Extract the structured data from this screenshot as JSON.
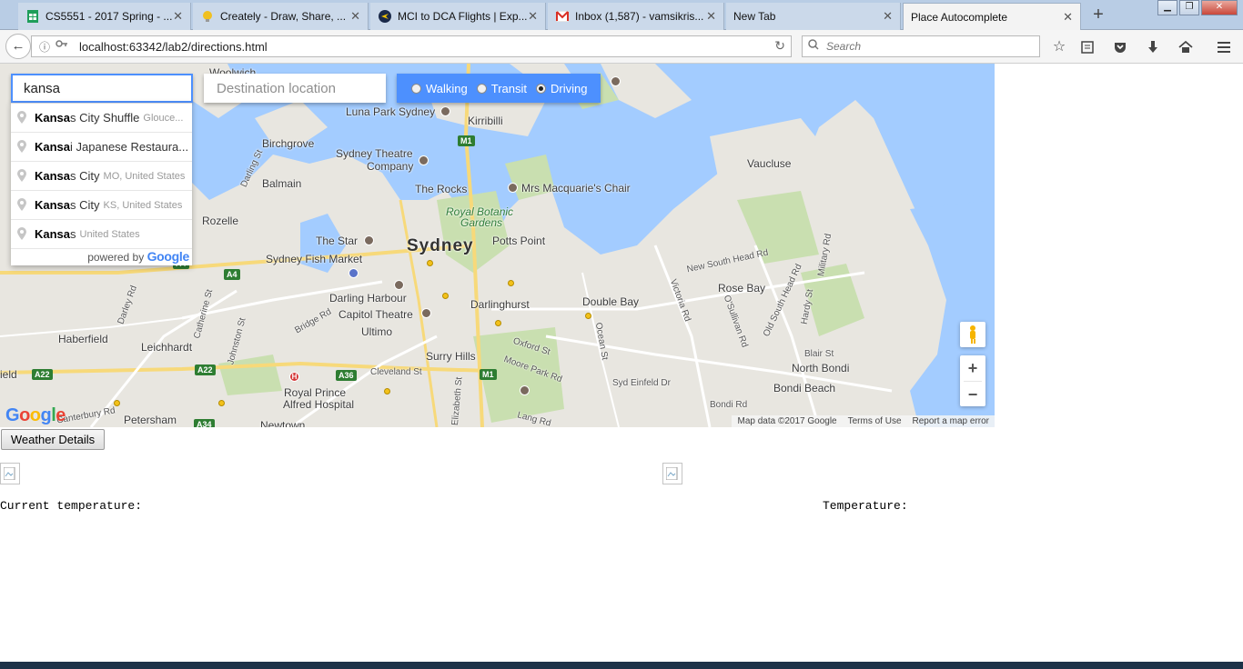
{
  "browser": {
    "tabs": [
      {
        "title": "CS5551 - 2017 Spring - ...",
        "icon": "sheets-icon",
        "color": "#1e9e5a"
      },
      {
        "title": "Creately - Draw, Share, ...",
        "icon": "bulb-icon",
        "color": "#f0c020"
      },
      {
        "title": "MCI to DCA Flights | Exp...",
        "icon": "plane-icon",
        "color": "#f5c400"
      },
      {
        "title": "Inbox (1,587) - vamsikris...",
        "icon": "gmail-icon",
        "color": "#d93025"
      },
      {
        "title": "New Tab",
        "icon": "",
        "color": ""
      },
      {
        "title": "Place Autocomplete",
        "icon": "",
        "color": "",
        "active": true
      }
    ],
    "url": "localhost:63342/lab2/directions.html",
    "search_placeholder": "Search"
  },
  "map": {
    "origin_value": "kansa",
    "destination_placeholder": "Destination location",
    "modes": [
      {
        "label": "Walking",
        "selected": false
      },
      {
        "label": "Transit",
        "selected": false
      },
      {
        "label": "Driving",
        "selected": true
      }
    ],
    "suggestions": [
      {
        "match": "Kansa",
        "rest": "s City Shuffle",
        "secondary": "Glouce..."
      },
      {
        "match": "Kansa",
        "rest": "i Japanese Restaura...",
        "secondary": ""
      },
      {
        "match": "Kansa",
        "rest": "s City",
        "secondary": "MO, United States"
      },
      {
        "match": "Kansa",
        "rest": "s City",
        "secondary": "KS, United States"
      },
      {
        "match": "Kansa",
        "rest": "s",
        "secondary": "United States"
      }
    ],
    "powered_by": "powered by",
    "google_word": "Google",
    "labels": {
      "woolwich": "Woolwich",
      "luna_park": "Luna Park Sydney",
      "kirribilli": "Kirribilli",
      "birchgrove": "Birchgrove",
      "sydney_theatre": "Sydney Theatre",
      "company": "Company",
      "balmain": "Balmain",
      "the_rocks": "The Rocks",
      "mrs_macquarie": "Mrs Macquarie's Chair",
      "vaucluse": "Vaucluse",
      "royal_botanic": "Royal Botanic",
      "gardens": "Gardens",
      "rozelle": "Rozelle",
      "the_star": "The Star",
      "sydney": "Sydney",
      "potts_point": "Potts Point",
      "sydney_fish": "Sydney Fish Market",
      "new_south_head": "New South Head Rd",
      "rose_bay": "Rose Bay",
      "darling_harbour": "Darling Harbour",
      "darlinghurst": "Darlinghurst",
      "double_bay": "Double Bay",
      "capitol": "Capitol Theatre",
      "haberfield": "Haberfield",
      "leichhardt": "Leichhardt",
      "ultimo": "Ultimo",
      "surry_hills": "Surry Hills",
      "blair_st": "Blair St",
      "north_bondi": "North Bondi",
      "bondi_beach": "Bondi Beach",
      "royal_prince": "Royal Prince",
      "alfred": "Alfred Hospital",
      "petersham": "Petersham",
      "newtown": "Newtown",
      "field": "ield",
      "oxford_st": "Oxford St",
      "moore_park": "Moore Park Rd",
      "syd_einfeld": "Syd Einfeld Dr",
      "bondi_rd": "Bondi Rd",
      "lang_rd": "Lang Rd",
      "cleveland_st": "Cleveland St",
      "bridge_rd": "Bridge Rd",
      "catherine_st": "Catherine St",
      "johnston_st": "Johnston St",
      "darley_rd": "Darley Rd",
      "victoria_rd": "Victoria Rd",
      "military_rd": "Military Rd",
      "old_south_head": "Old South Head Rd",
      "osullivan_rd": "O'Sullivan Rd",
      "hardy_st": "Hardy St",
      "ocean_st": "Ocean St",
      "darling_st": "Darling St",
      "elizabeth_st": "Elizabeth St",
      "canterbury_rd": "Canterbury Rd"
    },
    "shields": {
      "a4a": "A4",
      "a4b": "A4",
      "a22a": "A22",
      "a22b": "A22",
      "a36": "A36",
      "a34": "A34",
      "m1a": "M1",
      "m1b": "M1"
    },
    "hospital_letter": "H",
    "zoom_in": "+",
    "zoom_out": "−",
    "map_data": "Map data ©2017 Google",
    "terms": "Terms of Use",
    "report": "Report a map error"
  },
  "page": {
    "weather_button": "Weather Details",
    "current_temperature_label": "Current temperature:",
    "temperature_label": "Temperature:"
  },
  "colors": {
    "water": "#a3ccff",
    "land": "#e8e6e0",
    "park": "#c9dfb0",
    "accent_blue": "#4d90fe"
  }
}
